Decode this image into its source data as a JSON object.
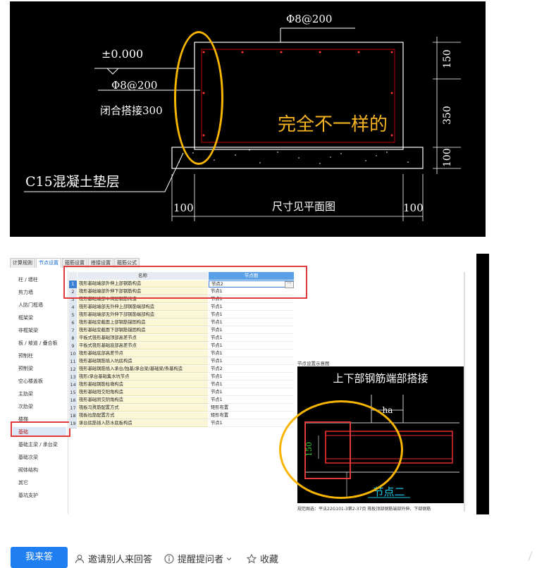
{
  "cad": {
    "elevation": "±0.000",
    "rebar_top": "Φ8@200",
    "rebar_left": "Φ8@200",
    "lap_note": "闭合搭接300",
    "annotation": "完全不一样的",
    "cushion": "C15混凝土垫层",
    "dim_right_top": "150",
    "dim_right_mid": "350",
    "dim_right_bottom": "100",
    "dim_left": "100",
    "dim_mid": "尺寸见平面图",
    "dim_right": "100"
  },
  "software": {
    "tabs": [
      "计算规则",
      "节点设置",
      "箍筋设置",
      "搭接设置",
      "箍筋公式"
    ],
    "active_tab": 1,
    "sidebar": [
      "柱 / 墙柱",
      "剪力墙",
      "人防门框墙",
      "框架梁",
      "非框架梁",
      "板 / 坡道 / 叠合板",
      "预制柱",
      "预制梁",
      "空心楼盖板",
      "主肋梁",
      "次肋梁",
      "楼梯",
      "基础",
      "基础主梁 / 承台梁",
      "基础次梁",
      "砌体结构",
      "其它",
      "基坑支护"
    ],
    "selected_sidebar": 12,
    "grid_header_name": "名称",
    "grid_header_node": "节点图",
    "rows": [
      {
        "n": "1",
        "name": "筏形基础端部外伸上部钢筋构造",
        "node": "节点2"
      },
      {
        "n": "2",
        "name": "筏形基础端部外伸下部钢筋构造",
        "node": "节点1"
      },
      {
        "n": "3",
        "name": "筏形基础端部中间层钢筋构造",
        "node": "节点1"
      },
      {
        "n": "4",
        "name": "筏形基础端部无外伸上部钢筋端部构造",
        "node": "节点1"
      },
      {
        "n": "5",
        "name": "筏形基础端部无外伸下部钢筋端部构造",
        "node": "节点1"
      },
      {
        "n": "6",
        "name": "筏形基础变截面上部钢筋锚固构造",
        "node": "节点1"
      },
      {
        "n": "7",
        "name": "筏形基础变截面下部钢筋锚固构造",
        "node": "节点1"
      },
      {
        "n": "8",
        "name": "平板式筏形基础顶部高差节点",
        "node": "节点1"
      },
      {
        "n": "9",
        "name": "平板式筏形基础底部高差节点",
        "node": "节点1"
      },
      {
        "n": "10",
        "name": "筏形基础底部高差节点",
        "node": "节点1"
      },
      {
        "n": "11",
        "name": "筏形基础钢筋插入坑底构造",
        "node": "节点1"
      },
      {
        "n": "12",
        "name": "筏形基础钢筋插入承台/独基/承台梁/基础梁/条基构造",
        "node": "节点2"
      },
      {
        "n": "13",
        "name": "筏形/承台基础集水坑节点",
        "node": "节点1"
      },
      {
        "n": "14",
        "name": "筏形基础钢筋柱墩构造",
        "node": "节点1"
      },
      {
        "n": "15",
        "name": "筏形基础阳交阳角构造",
        "node": "节点1"
      },
      {
        "n": "16",
        "name": "筏形基础阴交阴角构造",
        "node": "节点1"
      },
      {
        "n": "17",
        "name": "筏板马凳筋配置方式",
        "node": "矩形布置"
      },
      {
        "n": "18",
        "name": "筏板拉筋配置方式",
        "node": "矩形布置"
      },
      {
        "n": "19",
        "name": "承台底筋插入防水底板构造",
        "node": "节点1"
      }
    ],
    "preview_label": "节点设置示意图",
    "preview_title": "上下部钢筋端部搭接",
    "preview_dim_ha": "ha",
    "preview_dim_150": "150",
    "preview_node": "节点二",
    "preview_caption": "规范图选：平法22G101-3第2-37页   筏板顶部钢筋端部外伸、下部钢筋"
  },
  "actions": {
    "answer": "我来答",
    "invite": "邀请别人来回答",
    "remind": "提醒提问者",
    "favorite": "收藏"
  }
}
